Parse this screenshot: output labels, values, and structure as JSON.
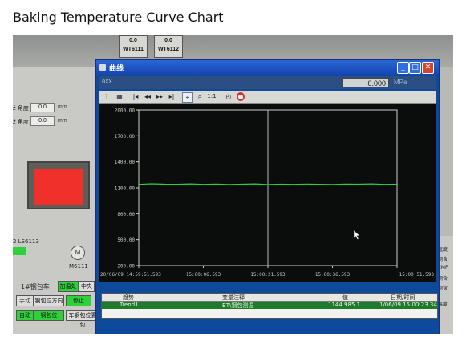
{
  "page_title": "Baking Temperature Curve Chart",
  "background": {
    "tanks": [
      {
        "value": "0.0",
        "tag": "WT6111"
      },
      {
        "value": "0.0",
        "tag": "WT6112"
      }
    ],
    "left_panel": {
      "field1": {
        "label": "ž 角度",
        "value": "0.0",
        "unit": "mm"
      },
      "field2": {
        "label": "ž 角度",
        "value": "0.0",
        "unit": "mm"
      },
      "motor_tag": "2 LS6113",
      "motor_code": "M6111",
      "car_label": "1#钢包车",
      "buttons": [
        "加温处",
        "中央",
        "手动",
        "钢包位方向",
        "停止",
        "自动",
        "钢包位",
        "车钢包位置包"
      ]
    },
    "right_panel": {
      "labels": [
        "温度",
        "钢含",
        "EMF",
        "钢含",
        "钢含",
        "温度"
      ]
    }
  },
  "window": {
    "title": "曲线",
    "pressure_label": "0XX",
    "pressure_value": "0.000",
    "pressure_unit": "MPa",
    "toolbar_icons": [
      "help-icon",
      "grid-icon",
      "first-icon",
      "prev-fast-icon",
      "next-fast-icon",
      "last-icon",
      "cursor-icon",
      "zoom-icon",
      "one-to-one-icon",
      "timer-icon",
      "stop-icon"
    ],
    "toolbar_zoom_label": "1:1"
  },
  "chart_data": {
    "type": "line",
    "y_tick_labels": [
      "2000.00",
      "1700.00",
      "1400.00",
      "1100.00",
      "800.00",
      "500.00",
      "200.00"
    ],
    "y_ticks": [
      2000,
      1700,
      1400,
      1100,
      800,
      500,
      200
    ],
    "ylim": [
      200,
      2000
    ],
    "x_tick_labels": [
      "20/06/09  14:59:51.593",
      "15:00:06.593",
      "15:00:21.593",
      "15:00:36.593",
      "15:00:51.593"
    ],
    "x_ticks_s": [
      0,
      15,
      30,
      45,
      60
    ],
    "xlim_s": [
      0,
      60
    ],
    "cursor_s": 30,
    "series": [
      {
        "color": "#2fcf3a",
        "x": [
          0,
          3,
          6,
          9,
          12,
          15,
          18,
          21,
          24,
          27,
          30,
          33,
          36,
          39,
          42,
          45,
          48,
          51,
          54,
          57,
          60
        ],
        "values": [
          1140,
          1146,
          1142,
          1141,
          1145,
          1140,
          1143,
          1139,
          1142,
          1145,
          1138,
          1142,
          1140,
          1144,
          1141,
          1139,
          1143,
          1142,
          1145,
          1140,
          1142
        ]
      }
    ],
    "grid": false
  },
  "footer": {
    "headers": [
      "趋势",
      "变量注释",
      "值",
      "日期/时间"
    ],
    "row": [
      "Trend1",
      "BT\\钢包测温",
      "1144.985 1",
      "1/06/09 15:00:23.34"
    ]
  },
  "colors": {
    "plot_bg": "#0a0d0c",
    "axis": "#d0d0c8",
    "series": "#2fcf3a",
    "title_bar": "#1446b4"
  }
}
